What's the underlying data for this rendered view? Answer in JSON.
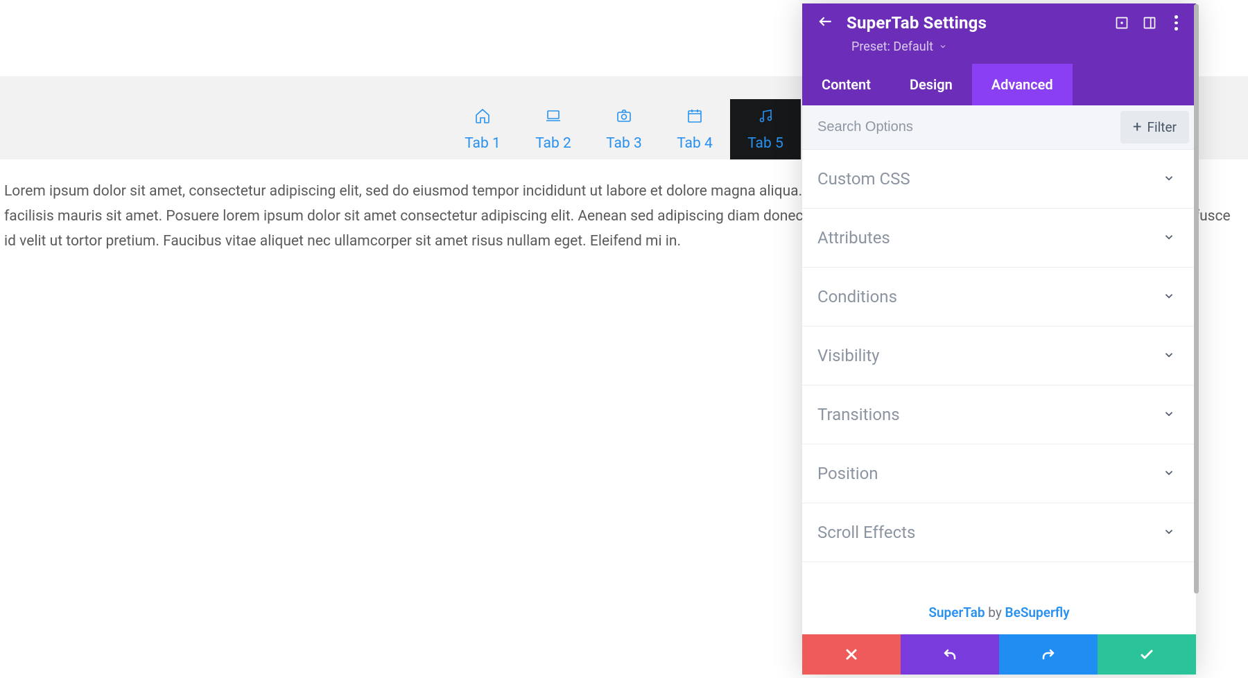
{
  "page": {
    "tabs": [
      {
        "label": "Tab 1",
        "icon": "home",
        "active": false
      },
      {
        "label": "Tab 2",
        "icon": "laptop",
        "active": false
      },
      {
        "label": "Tab 3",
        "icon": "camera",
        "active": false
      },
      {
        "label": "Tab 4",
        "icon": "calendar",
        "active": false
      },
      {
        "label": "Tab 5",
        "icon": "music",
        "active": true
      }
    ],
    "content_text": "Lorem ipsum dolor sit amet, consectetur adipiscing elit, sed do eiusmod tempor incididunt ut labore et dolore magna aliqua. Nulla aliquet porttitor lacus luctus. Sed vulputate mi sit amet facilisis mauris sit amet. Posuere lorem ipsum dolor sit amet consectetur adipiscing elit. Aenean sed adipiscing diam donec adipiscing. Risus sed vulputate odio ut enim. Tortor pretium fusce id velit ut tortor pretium. Faucibus vitae aliquet nec ullamcorper sit amet risus nullam eget. Eleifend mi in."
  },
  "panel": {
    "title": "SuperTab Settings",
    "preset_label": "Preset: Default",
    "tabs": [
      {
        "label": "Content",
        "active": false
      },
      {
        "label": "Design",
        "active": false
      },
      {
        "label": "Advanced",
        "active": true
      }
    ],
    "search_placeholder": "Search Options",
    "filter_label": "Filter",
    "sections": [
      {
        "label": "Custom CSS"
      },
      {
        "label": "Attributes"
      },
      {
        "label": "Conditions"
      },
      {
        "label": "Visibility"
      },
      {
        "label": "Transitions"
      },
      {
        "label": "Position"
      },
      {
        "label": "Scroll Effects"
      }
    ],
    "footer_note": {
      "brand": "SuperTab",
      "by": "by",
      "author": "BeSuperfly"
    }
  }
}
